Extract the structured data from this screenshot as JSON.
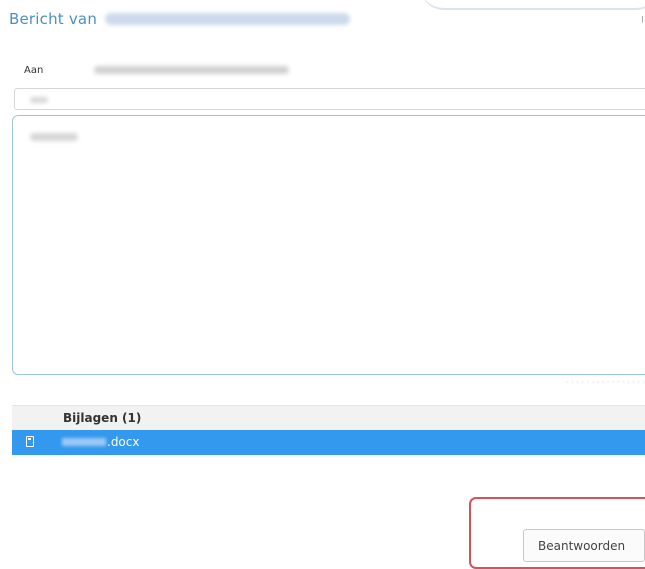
{
  "header": {
    "title": "Bericht van"
  },
  "recipient": {
    "label": "Aan"
  },
  "attachments": {
    "header_label": "Bijlagen (1)",
    "items": [
      {
        "extension": ".docx",
        "icon": "file-icon"
      }
    ]
  },
  "actions": {
    "reply_label": "Beantwoorden"
  },
  "colors": {
    "title": "#4a90c8",
    "selected_row": "#3399ee",
    "highlight_border": "#d9505a",
    "textarea_border": "#9fc3e6"
  }
}
